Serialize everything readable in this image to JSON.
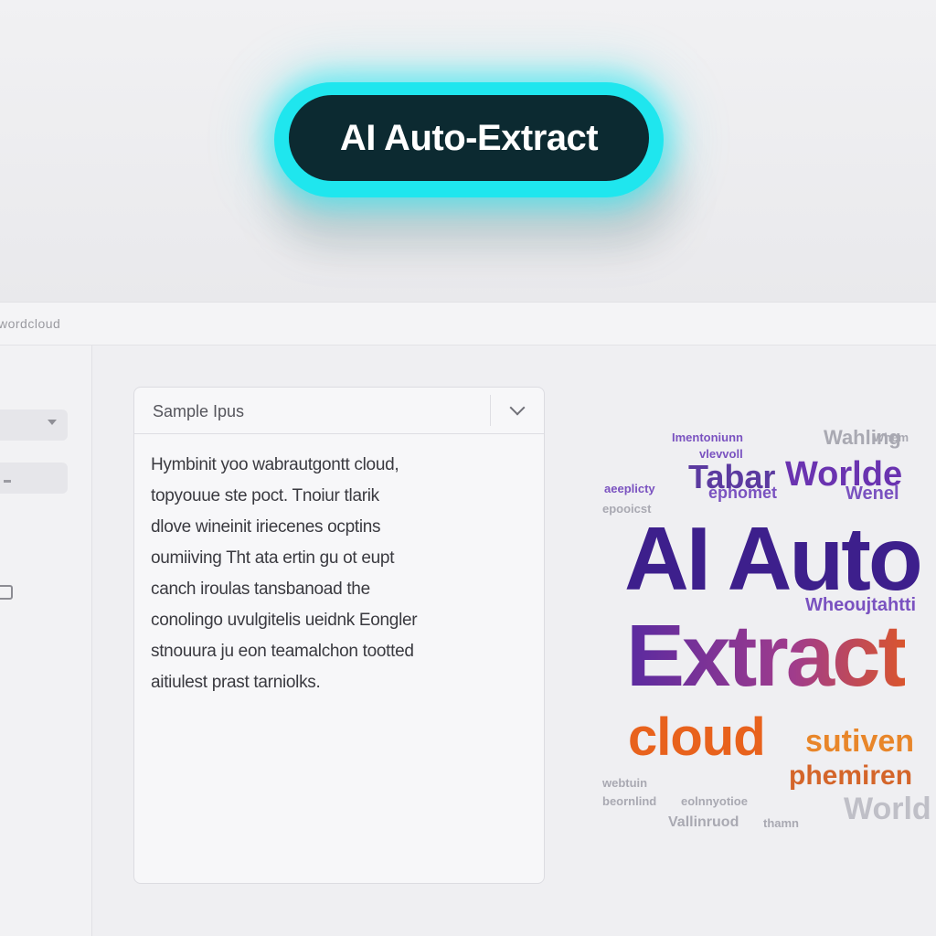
{
  "hero": {
    "cta_label": "AI Auto-Extract"
  },
  "app": {
    "header_title": "wordcloud"
  },
  "input_panel": {
    "title": "Sample Ipus",
    "lines": [
      "Hymbinit yoo wabrautgontt cloud,",
      "topyouue ste poct. Tnoiur tlarik",
      "dlove wineinit iriecenes ocptins",
      "oumiiving Tht ata ertin gu ot eupt",
      "canch iroulas tansbanoad the",
      "conolingo uvulgitelis ueidnk Eongler",
      "stnouura ju eon teamalchon tootted",
      "aitiulest prast tarniolks."
    ]
  },
  "word_cloud": {
    "big_words": [
      "AI Auto",
      "Extract",
      "cloud"
    ],
    "medium_words": [
      "Tabar",
      "Worlde",
      "sutiven",
      "phemiren",
      "World"
    ],
    "small_words": [
      "Imentoniunn",
      "Wahling",
      "vlevvoll",
      "aeeplicty",
      "ephomet",
      "Wenel",
      "epooicst",
      "Whem",
      "Wheoujtahtti",
      "webtuin",
      "beornlind",
      "eolnnyotioe",
      "Vallinruod",
      "thamn"
    ],
    "colors": {
      "primary": "#3d1f8c",
      "accent": "#e8621d",
      "glow": "#1fe6ee"
    }
  }
}
